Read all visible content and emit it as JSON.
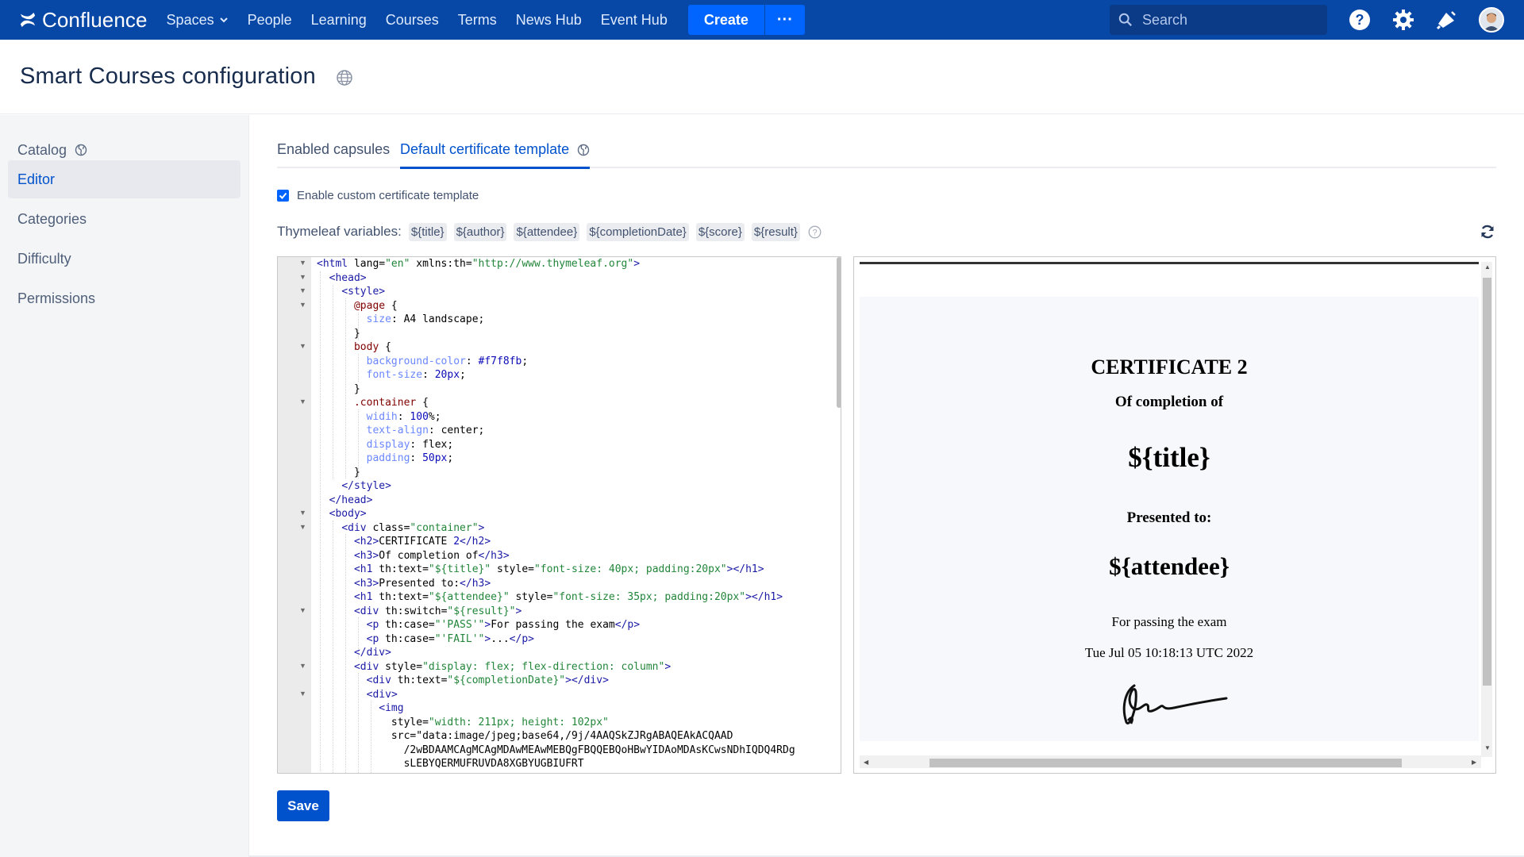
{
  "brand": {
    "name": "Confluence"
  },
  "nav": {
    "items": [
      "Spaces",
      "People",
      "Learning",
      "Courses",
      "Terms",
      "News Hub",
      "Event Hub"
    ],
    "create_label": "Create",
    "more_label": "···",
    "search_placeholder": "Search"
  },
  "page": {
    "title": "Smart Courses configuration"
  },
  "sidebar": {
    "items": [
      {
        "label": "Catalog",
        "icon": "globe-icon"
      },
      {
        "label": "Editor"
      },
      {
        "label": "Categories"
      },
      {
        "label": "Difficulty"
      },
      {
        "label": "Permissions"
      }
    ],
    "active": "Editor"
  },
  "tabs": {
    "items": [
      "Enabled capsules",
      "Default certificate template"
    ],
    "active": "Default certificate template"
  },
  "options": {
    "enable_custom_label": "Enable custom certificate template",
    "enable_custom_checked": true
  },
  "variables": {
    "label": "Thymeleaf variables:",
    "items": [
      "${title}",
      "${author}",
      "${attendee}",
      "${completionDate}",
      "${score}",
      "${result}"
    ]
  },
  "code_lines": [
    "<html lang=\"en\" xmlns:th=\"http://www.thymeleaf.org\">",
    "  <head>",
    "    <style>",
    "      @page {",
    "        size: A4 landscape;",
    "      }",
    "      body {",
    "        background-color: #f7f8fb;",
    "        font-size: 20px;",
    "      }",
    "      .container {",
    "        widih: 100%;",
    "        text-align: center;",
    "        display: flex;",
    "        padding: 50px;",
    "      }",
    "    </style>",
    "  </head>",
    "  <body>",
    "    <div class=\"container\">",
    "      <h2>CERTIFICATE 2</h2>",
    "      <h3>Of completion of</h3>",
    "      <h1 th:text=\"${title}\" style=\"font-size: 40px; padding:20px\"></h1>",
    "      <h3>Presented to:</h3>",
    "      <h1 th:text=\"${attendee}\" style=\"font-size: 35px; padding:20px\"></h1>",
    "      <div th:switch=\"${result}\">",
    "        <p th:case=\"'PASS'\">For passing the exam</p>",
    "        <p th:case=\"'FAIL'\">...</p>",
    "      </div>",
    "      <div style=\"display: flex; flex-direction: column\">",
    "        <div th:text=\"${completionDate}\"></div>",
    "        <div>",
    "          <img",
    "            style=\"width: 211px; height: 102px\"",
    "            src=\"data:image/jpeg;base64,/9j/4AAQSkZJRgABAQEAkACQAAD",
    "              /2wBDAAMCAgMCAgMDAwMEAwMEBQgFBQQEBQoHBwYIDAoMDAsKCwsNDhIQDQ4RDg",
    "              sLEBYQERMUFRUVDA8XGBYUGBIUFRT"
  ],
  "preview": {
    "h2": "CERTIFICATE 2",
    "h3_completion": "Of completion of",
    "title_var": "${title}",
    "h3_presented": "Presented to:",
    "attendee_var": "${attendee}",
    "result_text": "For passing the exam",
    "completion_date": "Tue Jul 05 10:18:13 UTC 2022"
  },
  "actions": {
    "save_label": "Save"
  },
  "colors": {
    "nav_bg": "#0747a6",
    "primary": "#0052cc",
    "create_btn": "#0065ff",
    "sidebar_bg": "#f4f5f7",
    "preview_page_bg": "#f7f8fb"
  }
}
